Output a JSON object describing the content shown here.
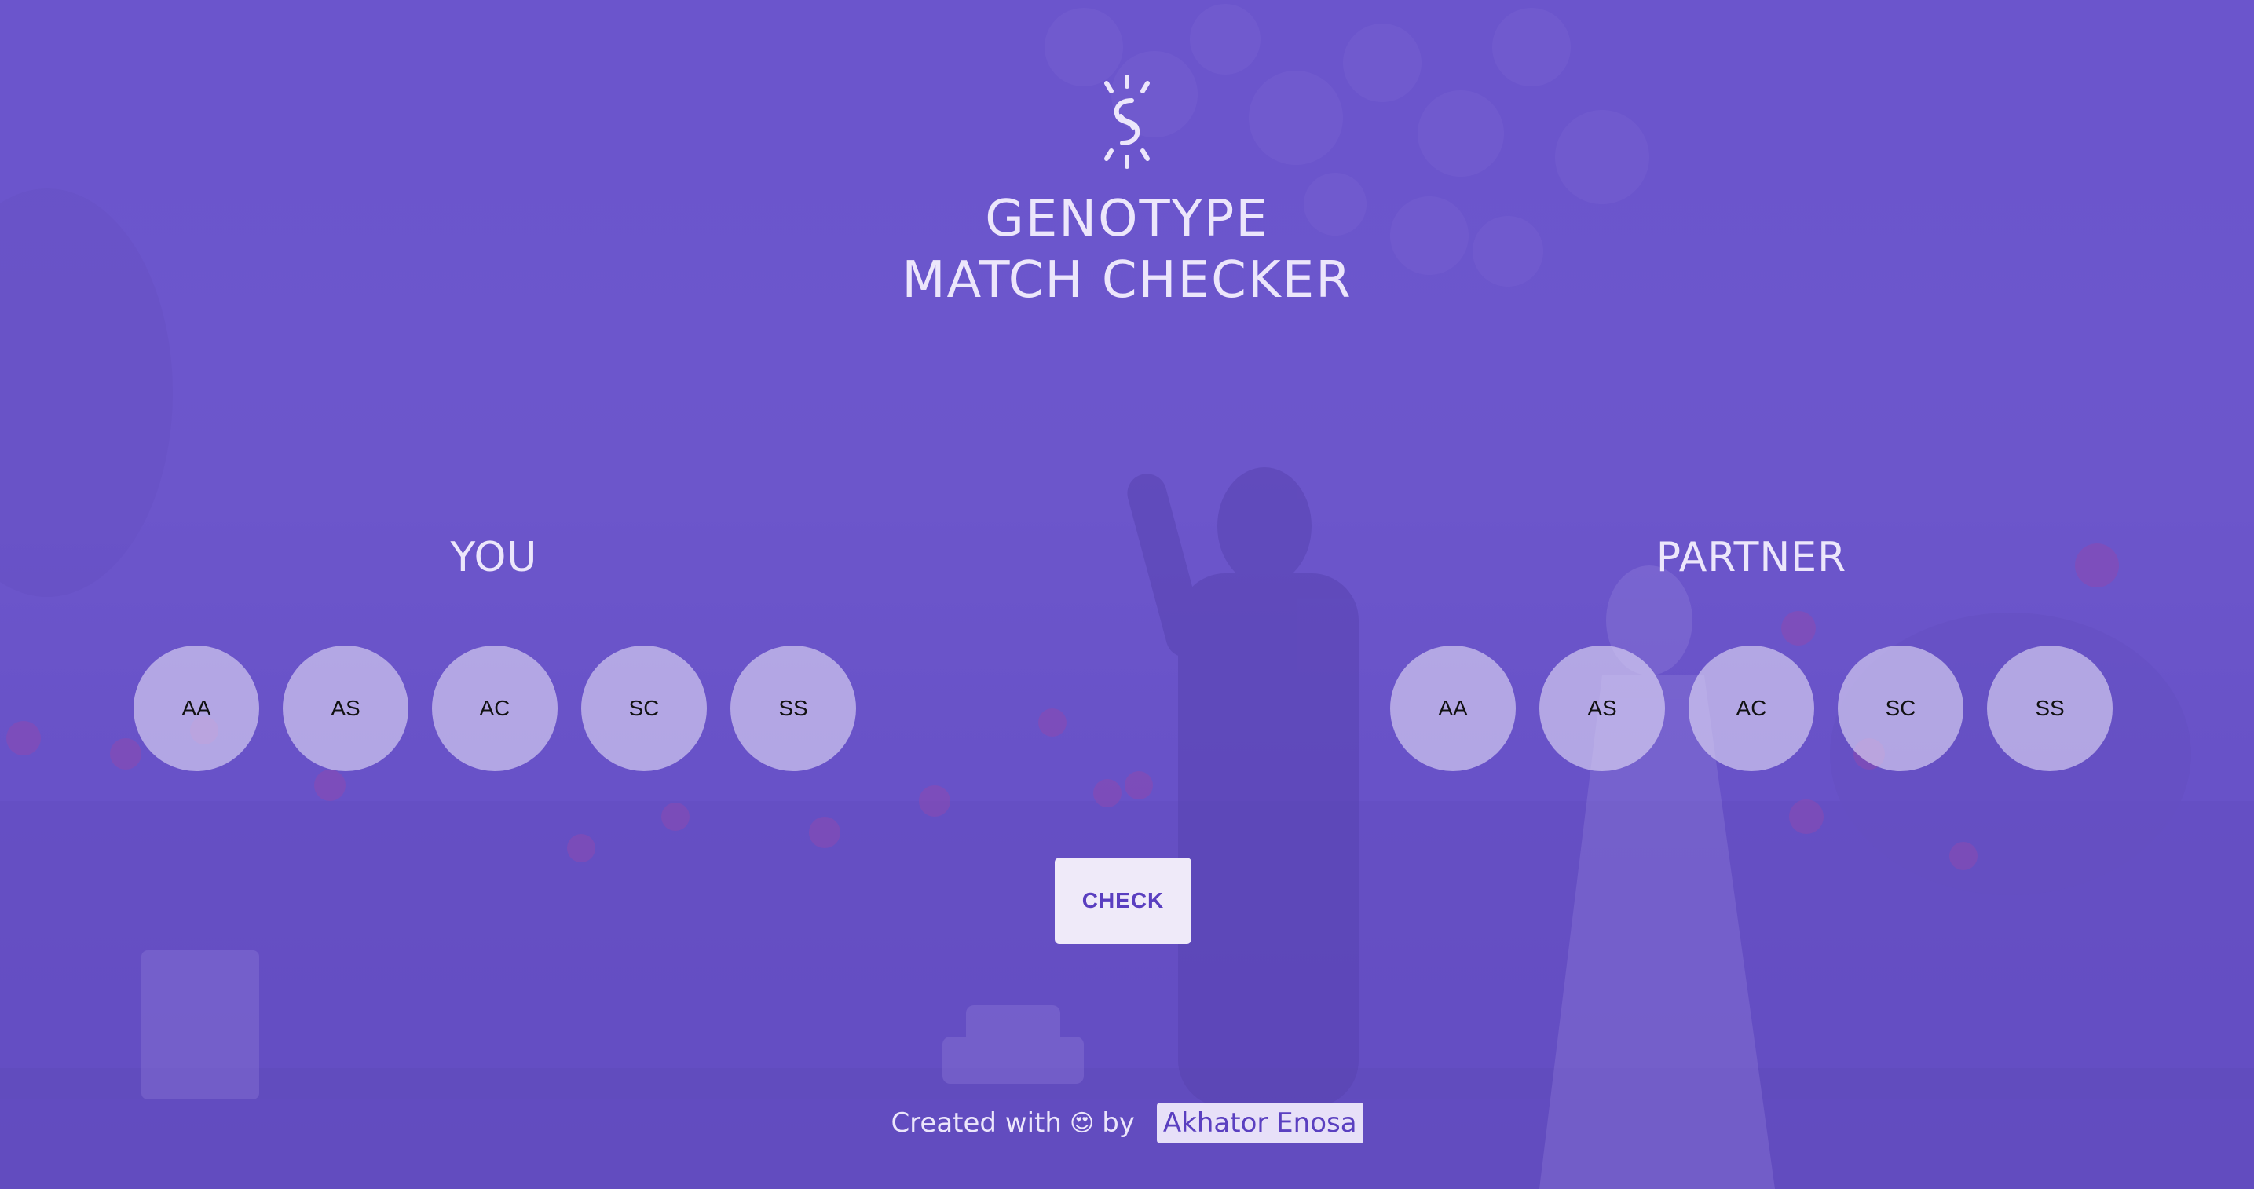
{
  "header": {
    "title_line1": "GENOTYPE",
    "title_line2": "MATCH CHECKER",
    "logo_icon": "chain-link-break-icon"
  },
  "you": {
    "label": "YOU",
    "options": [
      "AA",
      "AS",
      "AC",
      "SC",
      "SS"
    ]
  },
  "partner": {
    "label": "PARTNER",
    "options": [
      "AA",
      "AS",
      "AC",
      "SC",
      "SS"
    ]
  },
  "check_button": {
    "label": "CHECK"
  },
  "footer": {
    "prefix": "Created with",
    "emoji": "😍",
    "by": "by",
    "author": "Akhator Enosa"
  },
  "colors": {
    "overlay": "#6c56ce",
    "text": "#ece6fb",
    "button_text": "#5a3fc0",
    "option_bg": "#e1daf5"
  }
}
